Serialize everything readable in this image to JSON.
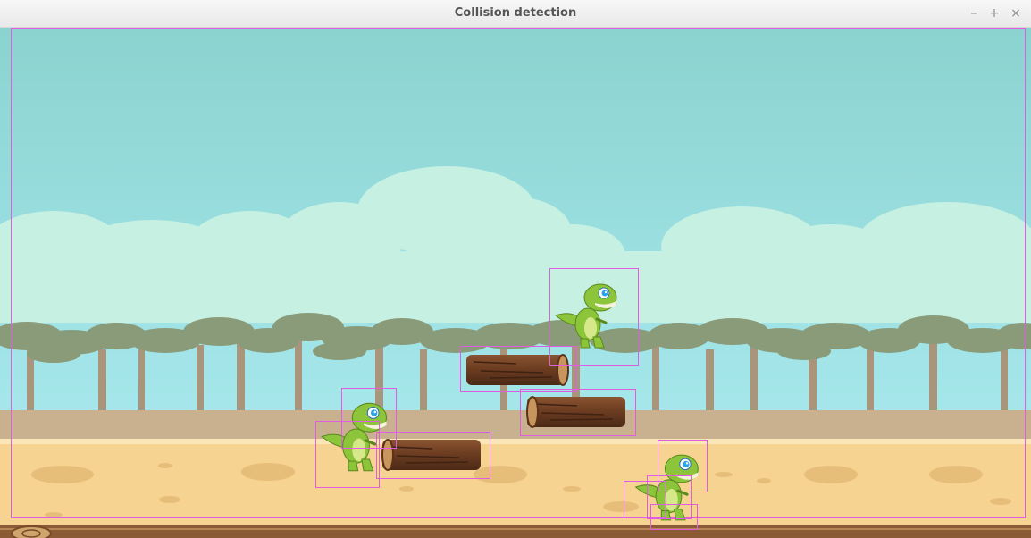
{
  "window": {
    "title": "Collision detection",
    "minimize_glyph": "–",
    "maximize_glyph": "+",
    "close_glyph": "×"
  },
  "colors": {
    "sky_top": "#8bd3cf",
    "sky_bottom": "#a6e9ec",
    "cloud": "#c3efe2",
    "tree": "#8a9b79",
    "trunk": "#a8957c",
    "ground": "#f7d493",
    "ground_stripe": "#c9b190",
    "log": "#6e3f22",
    "dino_body": "#8cc43a",
    "hitbox": "#e05ce0"
  },
  "scene": {
    "icons": [
      "dinosaur-sprite",
      "wooden-log-sprite"
    ],
    "sprites": [
      {
        "name": "dino-sprite-1",
        "kind": "dinosaur"
      },
      {
        "name": "dino-sprite-2",
        "kind": "dinosaur"
      },
      {
        "name": "dino-sprite-3",
        "kind": "dinosaur"
      },
      {
        "name": "log-sprite-1",
        "kind": "log"
      },
      {
        "name": "log-sprite-2",
        "kind": "log"
      },
      {
        "name": "log-sprite-3",
        "kind": "log"
      }
    ]
  }
}
